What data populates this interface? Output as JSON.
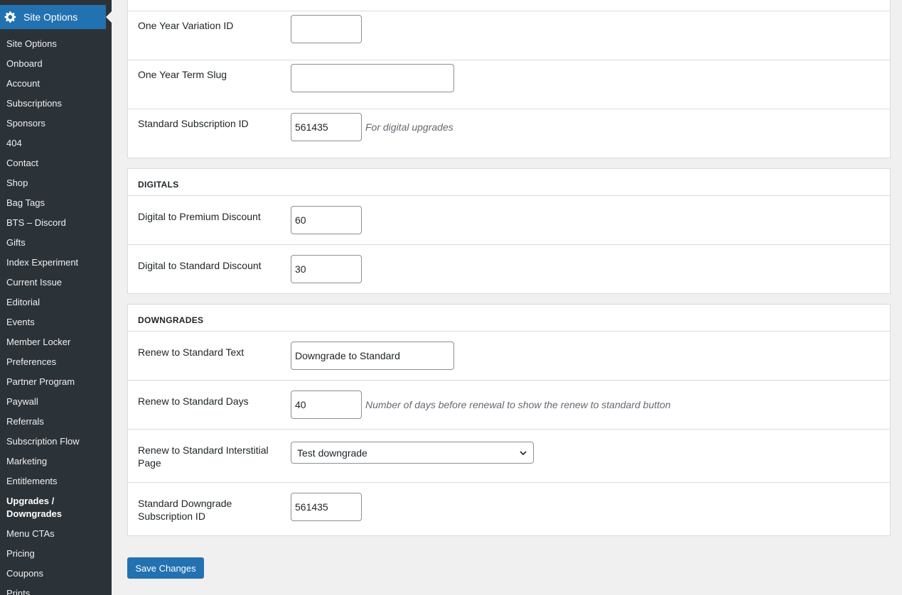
{
  "sidebar": {
    "header_label": "Site Options",
    "items": [
      {
        "label": "Site Options"
      },
      {
        "label": "Onboard"
      },
      {
        "label": "Account"
      },
      {
        "label": "Subscriptions"
      },
      {
        "label": "Sponsors"
      },
      {
        "label": "404"
      },
      {
        "label": "Contact"
      },
      {
        "label": "Shop"
      },
      {
        "label": "Bag Tags"
      },
      {
        "label": "BTS – Discord"
      },
      {
        "label": "Gifts"
      },
      {
        "label": "Index Experiment"
      },
      {
        "label": "Current Issue"
      },
      {
        "label": "Editorial"
      },
      {
        "label": "Events"
      },
      {
        "label": "Member Locker"
      },
      {
        "label": "Preferences"
      },
      {
        "label": "Partner Program"
      },
      {
        "label": "Paywall"
      },
      {
        "label": "Referrals"
      },
      {
        "label": "Subscription Flow"
      },
      {
        "label": "Marketing"
      },
      {
        "label": "Entitlements"
      },
      {
        "label": "Upgrades / Downgrades"
      },
      {
        "label": "Menu CTAs"
      },
      {
        "label": "Pricing"
      },
      {
        "label": "Coupons"
      },
      {
        "label": "Prints"
      }
    ]
  },
  "upgrades": {
    "one_year_variation_id": {
      "label": "One Year Variation ID",
      "value": ""
    },
    "one_year_term_slug": {
      "label": "One Year Term Slug",
      "value": ""
    },
    "standard_subscription_id": {
      "label": "Standard Subscription ID",
      "value": "561435",
      "hint": "For digital upgrades"
    }
  },
  "digitals": {
    "title": "DIGITALS",
    "premium_discount": {
      "label": "Digital to Premium Discount",
      "value": "60"
    },
    "standard_discount": {
      "label": "Digital to Standard Discount",
      "value": "30"
    }
  },
  "downgrades": {
    "title": "DOWNGRADES",
    "renew_text": {
      "label": "Renew to Standard Text",
      "value": "Downgrade to Standard"
    },
    "renew_days": {
      "label": "Renew to Standard Days",
      "value": "40",
      "hint": "Number of days before renewal to show the renew to standard button"
    },
    "interstitial": {
      "label": "Renew to Standard Interstitial Page",
      "value": "Test downgrade"
    },
    "downgrade_sub_id": {
      "label": "Standard Downgrade Subscription ID",
      "value": "561435"
    }
  },
  "save_label": "Save Changes",
  "colors": {
    "accent": "#2271b1",
    "sidebar_bg": "#2c3338",
    "page_bg": "#f0f0f1"
  }
}
